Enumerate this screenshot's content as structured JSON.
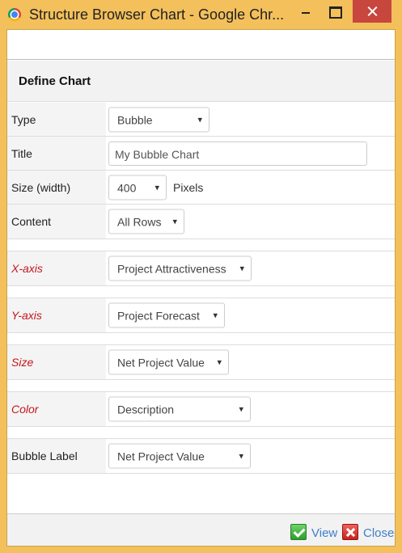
{
  "window": {
    "title": "Structure Browser Chart - Google Chr..."
  },
  "header": {
    "title": "Define Chart"
  },
  "fields": {
    "type": {
      "label": "Type",
      "value": "Bubble"
    },
    "title": {
      "label": "Title",
      "value": "My Bubble Chart"
    },
    "size_width": {
      "label": "Size (width)",
      "value": "400",
      "unit": "Pixels"
    },
    "content": {
      "label": "Content",
      "value": "All Rows"
    },
    "x_axis": {
      "label": "X-axis",
      "value": "Project Attractiveness",
      "required": true
    },
    "y_axis": {
      "label": "Y-axis",
      "value": "Project Forecast",
      "required": true
    },
    "size": {
      "label": "Size",
      "value": "Net Project Value",
      "required": true
    },
    "color": {
      "label": "Color",
      "value": "Description",
      "required": true
    },
    "bubble_label": {
      "label": "Bubble Label",
      "value": "Net Project Value"
    }
  },
  "footer": {
    "view_label": "View",
    "close_label": "Close"
  },
  "icons": {
    "dropdown_arrow": "▾",
    "view": "check-icon",
    "close": "close-x-icon"
  },
  "colors": {
    "window_frame": "#f3c05b",
    "required_label": "#c4161c",
    "link": "#3f7fc7",
    "close_button": "#c7463e"
  }
}
